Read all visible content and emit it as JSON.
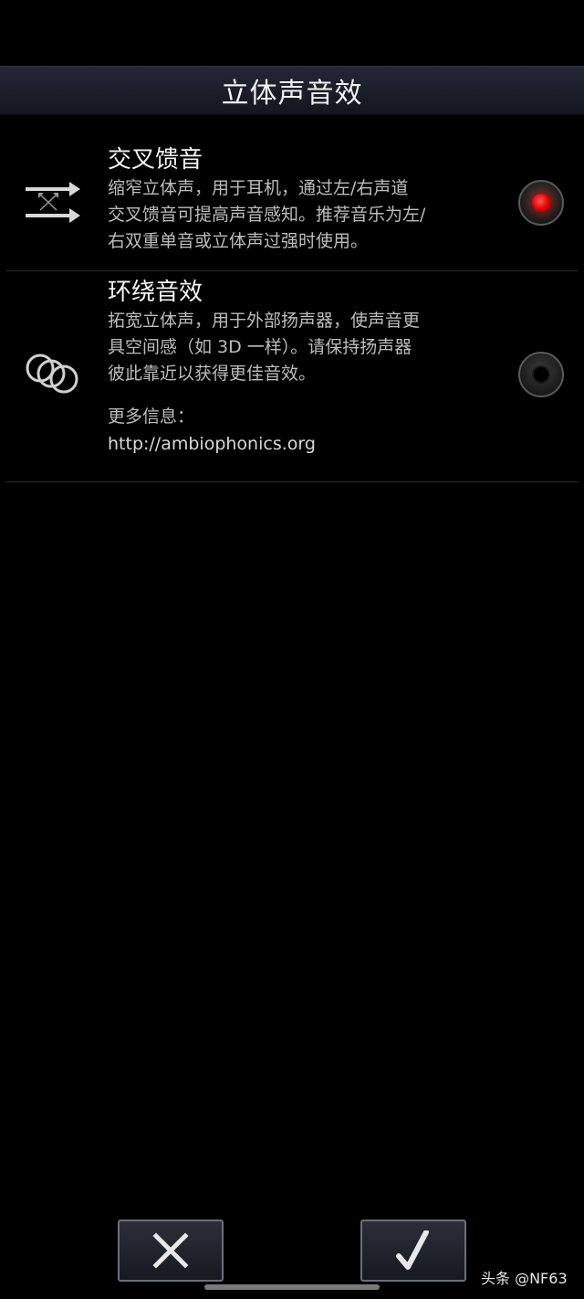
{
  "header": {
    "title": "立体声音效"
  },
  "options": [
    {
      "title": "交叉馈音",
      "desc": [
        "缩窄立体声，用于耳机，通过左/右声道",
        "交叉馈音可提高声音感知。推荐音乐为左/",
        "右双重单音或立体声过强时使用。"
      ],
      "icon": "crossfeed-arrows-icon",
      "selected": true
    },
    {
      "title": "环绕音效",
      "desc": [
        "拓宽立体声，用于外部扬声器，使声音更",
        "具空间感（如 3D 一样）。请保持扬声器",
        "彼此靠近以获得更佳音效。"
      ],
      "more_label": "更多信息：",
      "more_link": "http://ambiophonics.org",
      "icon": "surround-rings-icon",
      "selected": false
    }
  ],
  "buttons": {
    "cancel_icon": "close-icon",
    "ok_icon": "check-icon"
  },
  "watermark": "头条 @NF63",
  "colors": {
    "accent_selected": "#e00000",
    "background": "#000000",
    "header": "#1c1f2b"
  }
}
